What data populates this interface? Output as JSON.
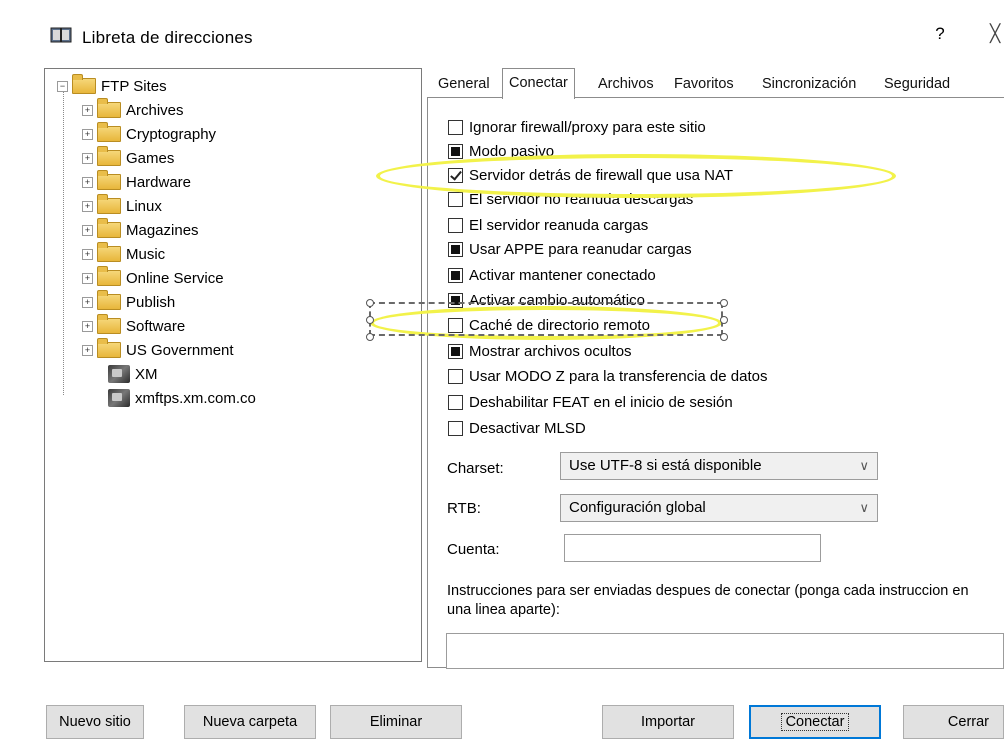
{
  "window": {
    "title": "Libreta de direcciones",
    "help_label": "?",
    "close_label": "X"
  },
  "tree": {
    "root": {
      "label": "FTP Sites",
      "expander": "−"
    },
    "folders": [
      {
        "label": "Archives",
        "expander": "+"
      },
      {
        "label": "Cryptography",
        "expander": "+"
      },
      {
        "label": "Games",
        "expander": "+"
      },
      {
        "label": "Hardware",
        "expander": "+"
      },
      {
        "label": "Linux",
        "expander": "+"
      },
      {
        "label": "Magazines",
        "expander": "+"
      },
      {
        "label": "Music",
        "expander": "+"
      },
      {
        "label": "Online Service",
        "expander": "+"
      },
      {
        "label": "Publish",
        "expander": "+"
      },
      {
        "label": "Software",
        "expander": "+"
      },
      {
        "label": "US Government",
        "expander": "+"
      }
    ],
    "sites": [
      {
        "label": "XM"
      },
      {
        "label": "xmftps.xm.com.co"
      }
    ]
  },
  "tabs": [
    {
      "label": "General"
    },
    {
      "label": "Conectar",
      "active": true
    },
    {
      "label": "Archivos"
    },
    {
      "label": "Favoritos"
    },
    {
      "label": "Sincronización"
    },
    {
      "label": "Seguridad"
    }
  ],
  "options": [
    {
      "label": "Ignorar firewall/proxy para este sitio",
      "state": "unchecked"
    },
    {
      "label": "Modo pasivo",
      "state": "indeterminate"
    },
    {
      "label": "Servidor detrás de firewall que usa NAT",
      "state": "checked"
    },
    {
      "label": "El servidor no reanuda descargas",
      "state": "unchecked"
    },
    {
      "label": "El servidor reanuda cargas",
      "state": "unchecked"
    },
    {
      "label": "Usar APPE para reanudar cargas",
      "state": "indeterminate"
    },
    {
      "label": "Activar mantener conectado",
      "state": "indeterminate"
    },
    {
      "label": "Activar cambio automático",
      "state": "indeterminate"
    },
    {
      "label": "Caché de directorio remoto",
      "state": "unchecked"
    },
    {
      "label": "Mostrar archivos ocultos",
      "state": "indeterminate"
    },
    {
      "label": "Usar MODO  Z para la transferencia de datos",
      "state": "unchecked"
    },
    {
      "label": "Deshabilitar FEAT en el inicio de sesión",
      "state": "unchecked"
    },
    {
      "label": "Desactivar MLSD",
      "state": "unchecked"
    }
  ],
  "fields": {
    "charset": {
      "label": "Charset:",
      "value": "Use UTF-8 si está disponible"
    },
    "rtb": {
      "label": "RTB:",
      "value": "Configuración global"
    },
    "cuenta": {
      "label": "Cuenta:",
      "value": ""
    },
    "instructions": {
      "label": "Instrucciones para ser enviadas despues de conectar (ponga cada instruccion en una linea aparte):",
      "value": ""
    }
  },
  "buttons": {
    "new_site": "Nuevo sitio",
    "new_folder": "Nueva carpeta",
    "delete": "Eliminar",
    "import": "Importar",
    "connect": "Conectar",
    "close": "Cerrar"
  },
  "annotations": {
    "highlight_color": "#f2f24a"
  }
}
